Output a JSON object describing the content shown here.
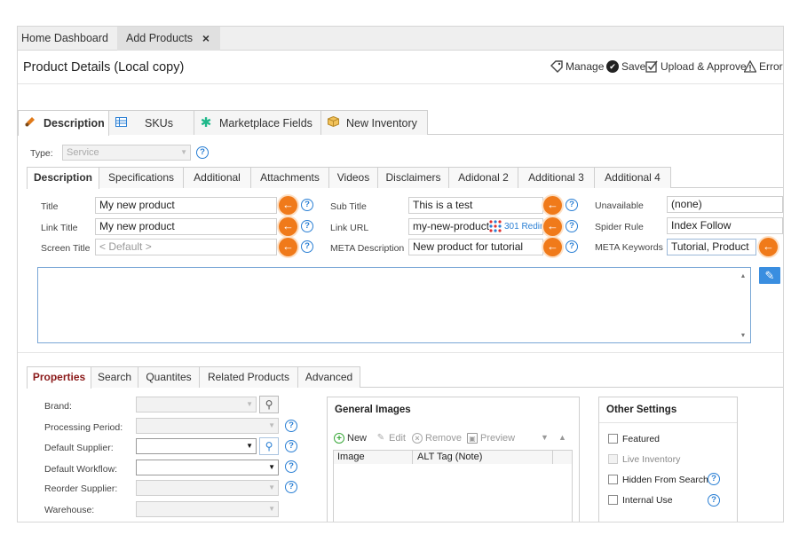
{
  "top_tabs": [
    {
      "label": "Home Dashboard"
    },
    {
      "label": "Add Products",
      "close": "×"
    }
  ],
  "header": {
    "title": "Product Details (Local copy)",
    "actions": {
      "manage": "Manage",
      "save": "Save",
      "upload": "Upload & Approve",
      "errors": "Errors"
    }
  },
  "main_tabs": [
    {
      "label": "Description",
      "icon": "brush-icon"
    },
    {
      "label": "SKUs",
      "icon": "grid-icon"
    },
    {
      "label": "Marketplace Fields",
      "icon": "asterisk-icon"
    },
    {
      "label": "New Inventory",
      "icon": "box-icon"
    }
  ],
  "type_field": {
    "label": "Type:",
    "value": "Service"
  },
  "inner_tabs": [
    "Description",
    "Specifications",
    "Additional",
    "Attachments",
    "Videos",
    "Disclaimers",
    "Adidonal 2",
    "Additional 3",
    "Additional 4"
  ],
  "fields": {
    "title": {
      "label": "Title",
      "value": "My new product"
    },
    "link_title": {
      "label": "Link Title",
      "value": "My new product"
    },
    "screen_title": {
      "label": "Screen Title",
      "placeholder": "< Default >"
    },
    "sub_title": {
      "label": "Sub Title",
      "value": "This is a test"
    },
    "link_url": {
      "label": "Link URL",
      "value": "my-new-product",
      "redirect": "301 Redir"
    },
    "meta_description": {
      "label": "META Description",
      "value": "New product for tutorial"
    },
    "unavailable": {
      "label": "Unavailable",
      "value": "(none)"
    },
    "spider_rule": {
      "label": "Spider Rule",
      "value": "Index Follow"
    },
    "meta_keywords": {
      "label": "META Keywords",
      "value": "Tutorial, Product"
    }
  },
  "bottom_tabs": [
    "Properties",
    "Search",
    "Quantites",
    "Related Products",
    "Advanced"
  ],
  "properties": {
    "brand": "Brand:",
    "processing_period": "Processing Period:",
    "default_supplier": "Default Supplier:",
    "default_workflow": "Default Workflow:",
    "reorder_supplier": "Reorder Supplier:",
    "warehouse": "Warehouse:"
  },
  "general_images": {
    "title": "General Images",
    "toolbar": {
      "new": "New",
      "edit": "Edit",
      "remove": "Remove",
      "preview": "Preview"
    },
    "columns": [
      "Image",
      "ALT Tag (Note)"
    ]
  },
  "other_settings": {
    "title": "Other Settings",
    "options": [
      {
        "label": "Featured",
        "enabled": true
      },
      {
        "label": "Live Inventory",
        "enabled": false
      },
      {
        "label": "Hidden From Search",
        "enabled": true
      },
      {
        "label": "Internal Use",
        "enabled": true
      }
    ]
  },
  "colors": {
    "accent_orange": "#f07a1a",
    "link_blue": "#2a7fd4",
    "active_tab_red": "#8b1a1a"
  }
}
